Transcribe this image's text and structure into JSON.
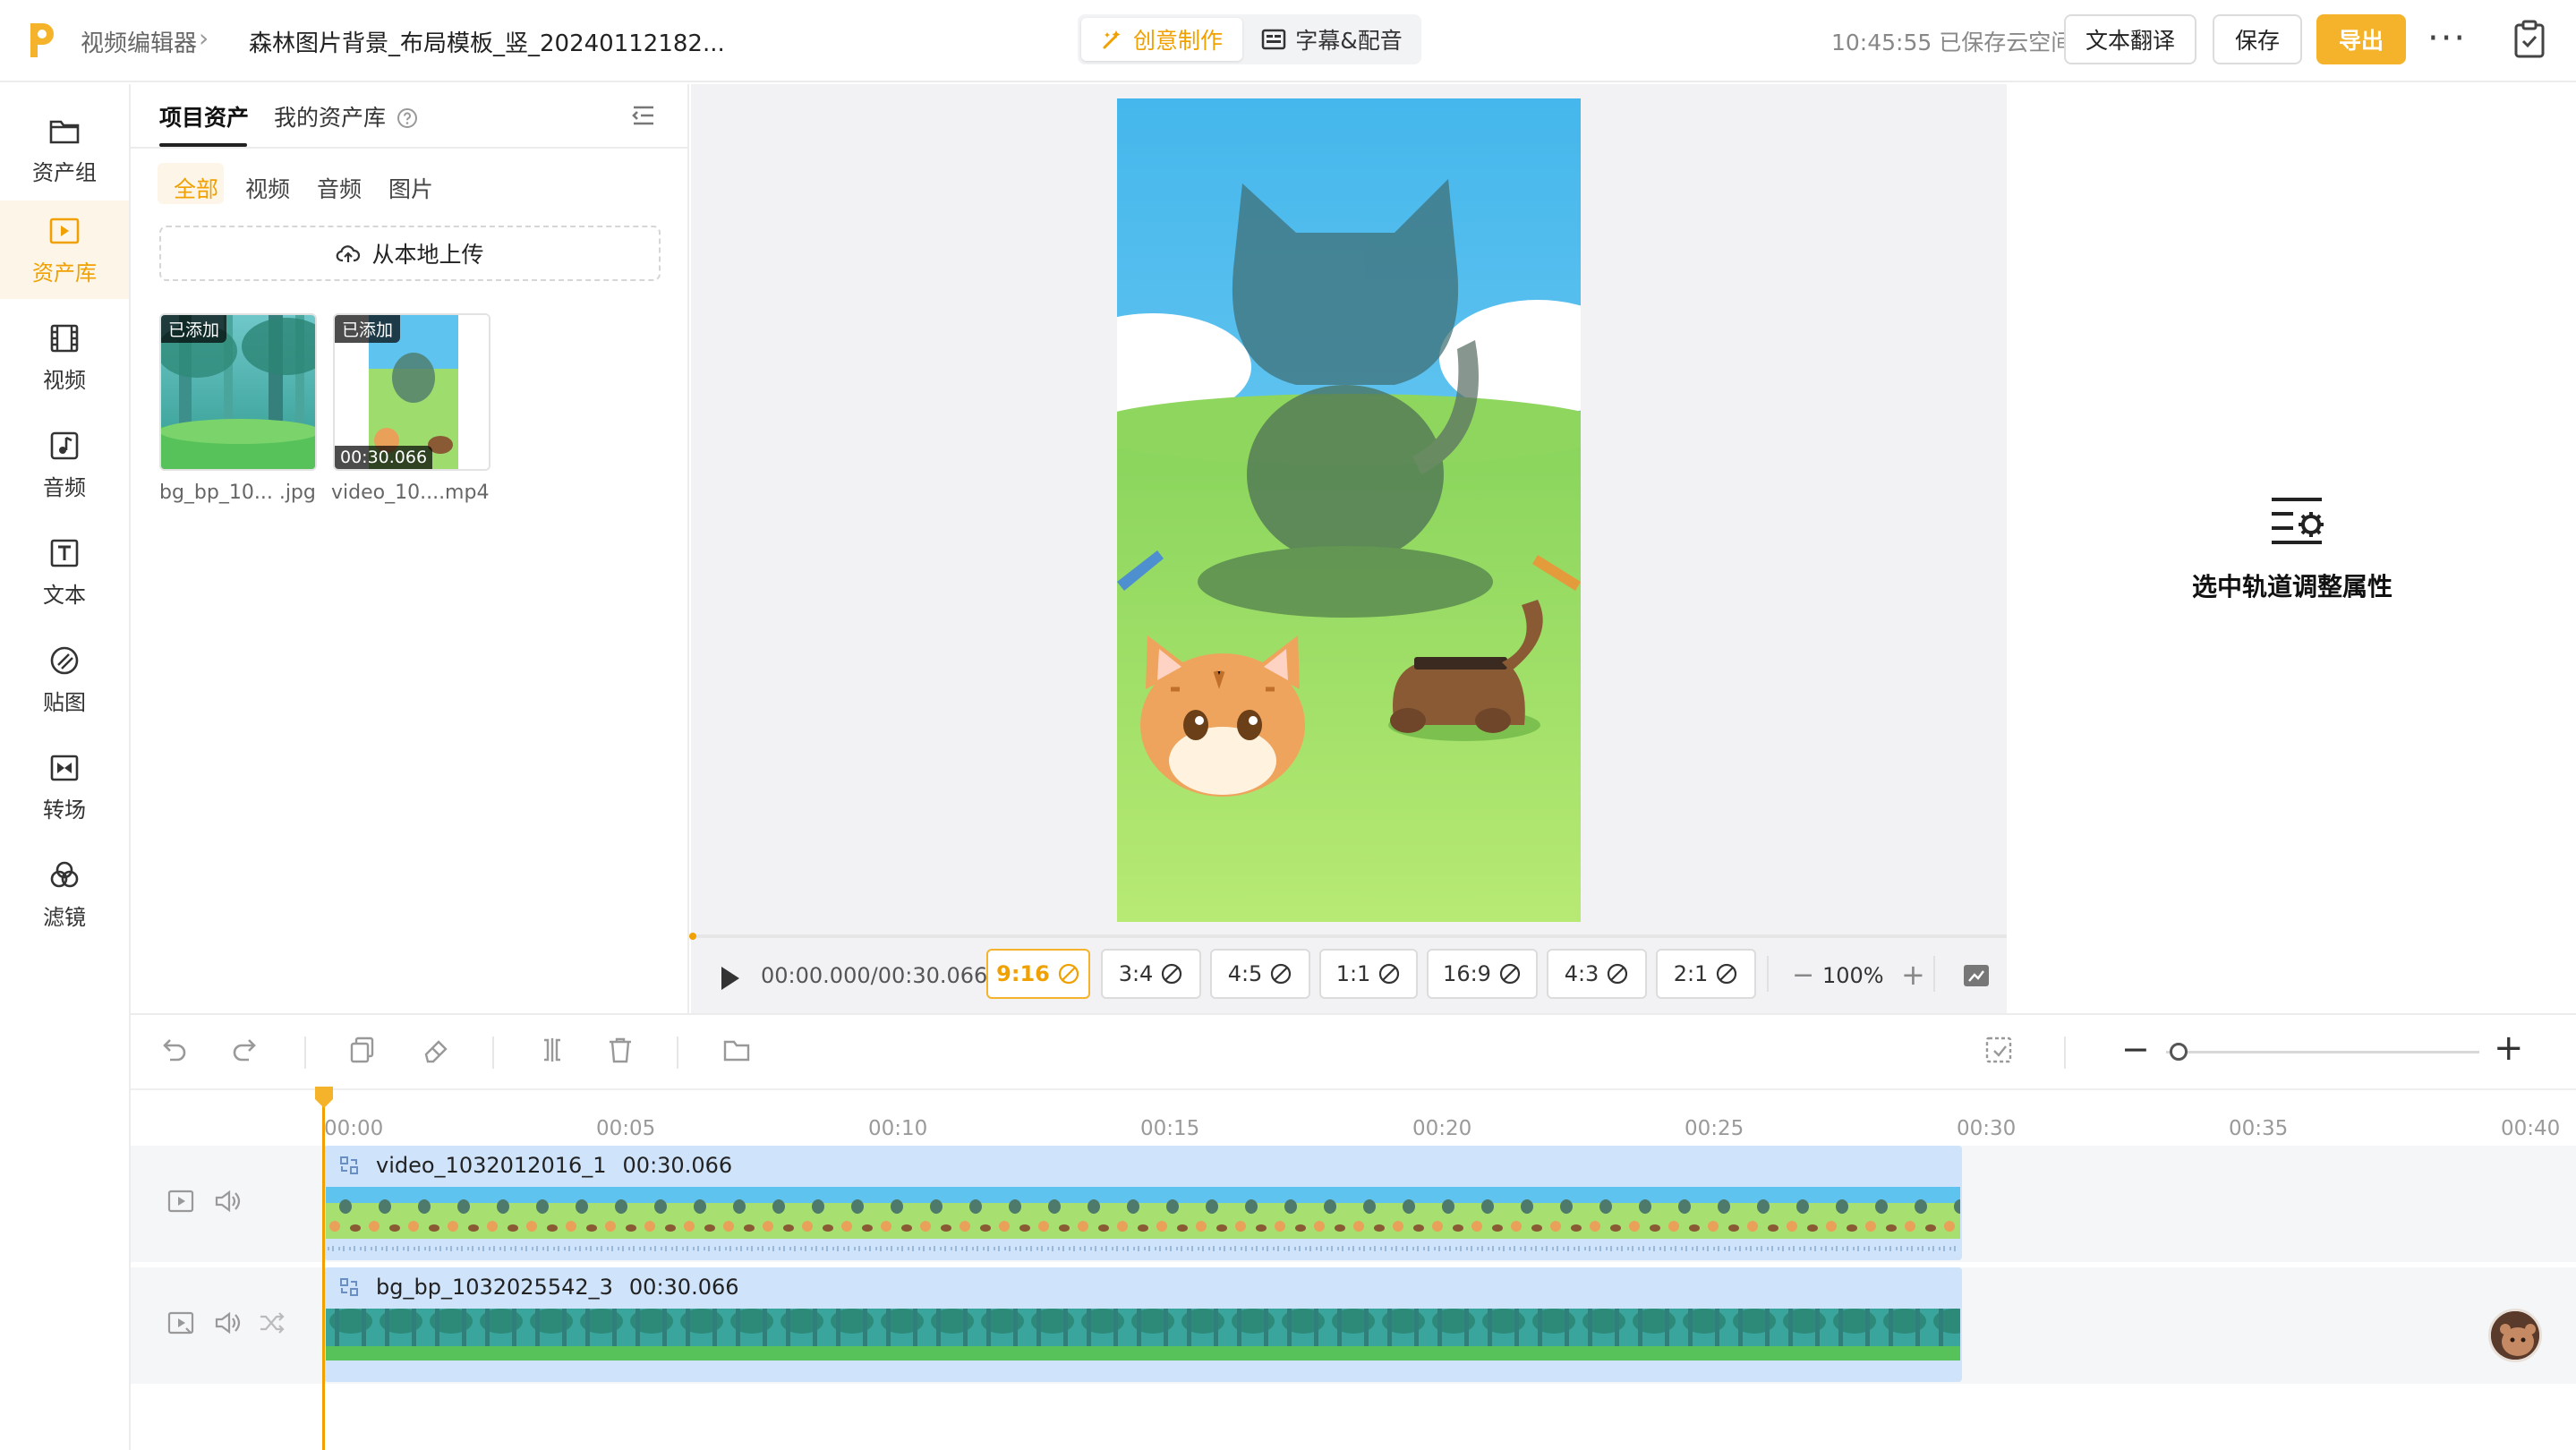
{
  "app": {
    "breadcrumb_root": "视频编辑器",
    "project_title": "森林图片背景_布局模板_竖_20240112182...",
    "mode_tabs": [
      "创意制作",
      "字幕&配音"
    ],
    "save_status": "10:45:55 已保存云空间",
    "buttons": {
      "translate": "文本翻译",
      "save": "保存",
      "export": "导出",
      "more": "···"
    },
    "colors": {
      "accent": "#f5b32b",
      "accent_text": "#f0a000",
      "clip": "#cfe3fb"
    }
  },
  "rail": {
    "items": [
      {
        "label": "资产组",
        "icon": "folder-icon"
      },
      {
        "label": "资产库",
        "icon": "play-square-icon",
        "active": true
      },
      {
        "label": "视频",
        "icon": "film-icon"
      },
      {
        "label": "音频",
        "icon": "music-note-icon"
      },
      {
        "label": "文本",
        "icon": "text-t-icon"
      },
      {
        "label": "贴图",
        "icon": "sticker-icon"
      },
      {
        "label": "转场",
        "icon": "transition-icon"
      },
      {
        "label": "滤镜",
        "icon": "filter-circles-icon"
      }
    ]
  },
  "assets": {
    "tabs": [
      "项目资产",
      "我的资产库"
    ],
    "filters": [
      "全部",
      "视频",
      "音频",
      "图片"
    ],
    "upload_label": "从本地上传",
    "items": [
      {
        "name": "bg_bp_10... .jpg",
        "badge": "已添加"
      },
      {
        "name": "video_10....mp4",
        "badge": "已添加",
        "duration": "00:30.066"
      }
    ]
  },
  "preview": {
    "time": "00:00.000/00:30.066",
    "ratios": [
      "9:16",
      "3:4",
      "4:5",
      "1:1",
      "16:9",
      "4:3",
      "2:1"
    ],
    "active_ratio": "9:16",
    "zoom": "100%",
    "zoom_minus": "−",
    "zoom_plus": "+"
  },
  "properties": {
    "hint": "选中轨道调整属性"
  },
  "timeline": {
    "ticks": [
      "00:00",
      "00:05",
      "00:10",
      "00:15",
      "00:20",
      "00:25",
      "00:30",
      "00:35",
      "00:40"
    ],
    "zoom_minus": "−",
    "zoom_plus": "+",
    "tracks": [
      {
        "name": "video_1032012016_1",
        "duration": "00:30.066"
      },
      {
        "name": "bg_bp_1032025542_3",
        "duration": "00:30.066"
      }
    ]
  }
}
